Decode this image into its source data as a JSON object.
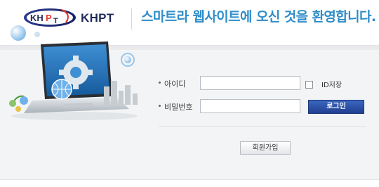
{
  "header": {
    "logo_mark": "KHPT",
    "logo_text": "KHPT",
    "welcome": "스마트라 웹사이트에 오신 것을 환영합니다."
  },
  "login": {
    "id_label": "아이디",
    "id_value": "",
    "password_label": "비밀번호",
    "password_value": "",
    "save_id_label": "ID저장",
    "save_id_checked": false,
    "login_button": "로그인",
    "signup_button": "회원가입"
  },
  "illustration": {
    "icons": [
      "laptop-icon",
      "gear-icon",
      "globe-icon",
      "cityscape-icon"
    ]
  },
  "colors": {
    "brand_navy": "#1f2a57",
    "welcome_blue": "#2f8dc9",
    "login_button": "#223f8f",
    "panel_bg": "#f3f4f5"
  }
}
